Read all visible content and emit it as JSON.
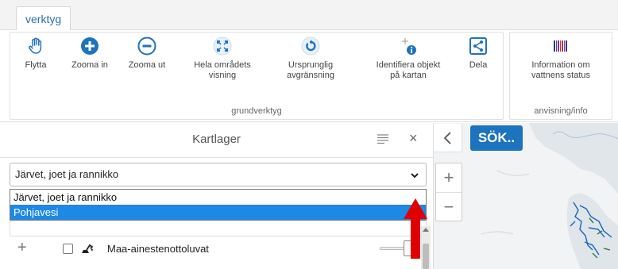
{
  "ribbon": {
    "tab_label": "verktyg",
    "groups": [
      {
        "label": "grundverktyg"
      },
      {
        "label": "anvisning/info"
      }
    ],
    "tools": {
      "pan": "Flytta",
      "zoom_in": "Zooma in",
      "zoom_out": "Zooma ut",
      "full_extent_1": "Hela områdets",
      "full_extent_2": "visning",
      "initial_extent_1": "Ursprunglig",
      "initial_extent_2": "avgränsning",
      "identify_1": "Identifiera objekt",
      "identify_2": "på kartan",
      "share": "Dela",
      "status_1": "Information om",
      "status_2": "vattnens status"
    }
  },
  "panel": {
    "title": "Kartlager",
    "select_value": "Järvet, joet ja rannikko",
    "options": [
      "Järvet, joet ja rannikko",
      "Pohjavesi"
    ],
    "selected_option_index": 1,
    "layer_name": "Maa-ainestenottoluvat"
  },
  "map": {
    "search_label": "SÖK.."
  },
  "colors": {
    "accent": "#1e73be",
    "option_highlight": "#1e88e5",
    "arrow": "#e00000"
  }
}
